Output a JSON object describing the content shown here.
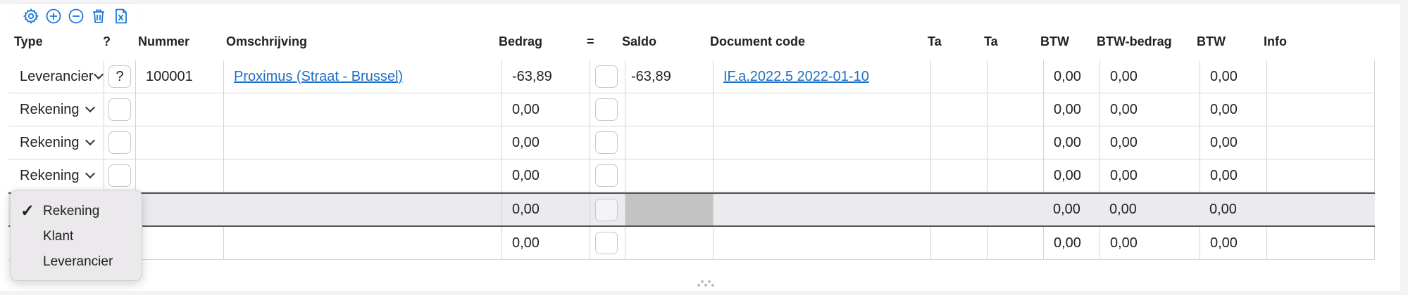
{
  "toolbar": {
    "icons": [
      "gear-icon",
      "plus-circle-icon",
      "minus-circle-icon",
      "trash-icon",
      "excel-icon"
    ]
  },
  "columns": {
    "type": "Type",
    "question": "?",
    "nummer": "Nummer",
    "omschrijving": "Omschrijving",
    "bedrag": "Bedrag",
    "equals": "=",
    "saldo": "Saldo",
    "document_code": "Document code",
    "ta1": "Ta",
    "ta2": "Ta",
    "btw1": "BTW",
    "btw_bedrag": "BTW-bedrag",
    "btw2": "BTW",
    "info": "Info"
  },
  "rows": [
    {
      "type": "Leverancier",
      "question": "?",
      "nummer": "100001",
      "omschrijving": "Proximus (Straat - Brussel)",
      "bedrag": "-63,89",
      "saldo": "-63,89",
      "document_code": "IF.a.2022.5 2022-01-10",
      "btw1": "0,00",
      "btw_bedrag": "0,00",
      "btw2": "0,00"
    },
    {
      "type": "Rekening",
      "question": "",
      "nummer": "",
      "omschrijving": "",
      "bedrag": "0,00",
      "saldo": "",
      "document_code": "",
      "btw1": "0,00",
      "btw_bedrag": "0,00",
      "btw2": "0,00"
    },
    {
      "type": "Rekening",
      "question": "",
      "nummer": "",
      "omschrijving": "",
      "bedrag": "0,00",
      "saldo": "",
      "document_code": "",
      "btw1": "0,00",
      "btw_bedrag": "0,00",
      "btw2": "0,00"
    },
    {
      "type": "Rekening",
      "question": "",
      "nummer": "",
      "omschrijving": "",
      "bedrag": "0,00",
      "saldo": "",
      "document_code": "",
      "btw1": "0,00",
      "btw_bedrag": "0,00",
      "btw2": "0,00"
    },
    {
      "type": "",
      "question": "",
      "nummer": "",
      "omschrijving": "",
      "bedrag": "0,00",
      "saldo": "",
      "document_code": "",
      "btw1": "0,00",
      "btw_bedrag": "0,00",
      "btw2": "0,00"
    },
    {
      "type": "",
      "question": "",
      "nummer": "",
      "omschrijving": "",
      "bedrag": "0,00",
      "saldo": "",
      "document_code": "",
      "btw1": "0,00",
      "btw_bedrag": "0,00",
      "btw2": "0,00"
    }
  ],
  "type_menu": {
    "selected": "Rekening",
    "options": [
      "Rekening",
      "Klant",
      "Leverancier"
    ]
  }
}
